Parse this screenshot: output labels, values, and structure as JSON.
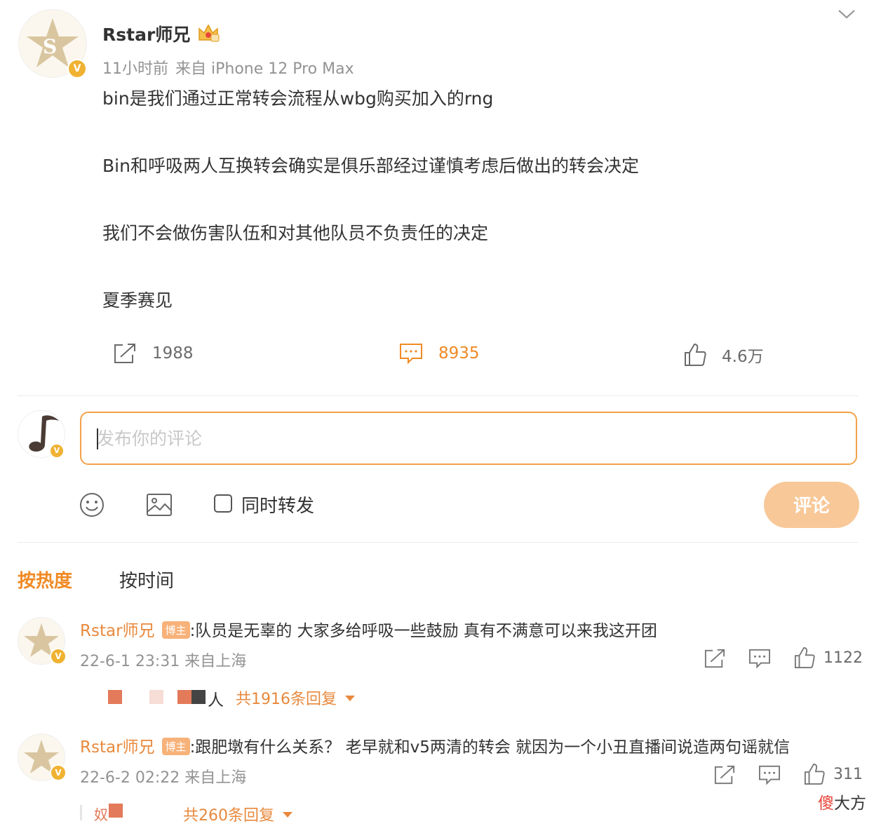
{
  "post": {
    "author": "Rstar师兄",
    "time": "11小时前",
    "source": "来自 iPhone 12 Pro Max",
    "paragraphs": [
      "bin是我们通过正常转会流程从wbg购买加入的rng",
      "Bin和呼吸两人互换转会确实是俱乐部经过谨慎考虑后做出的转会决定",
      "我们不会做伤害队伍和对其他队员不负责任的决定",
      "夏季赛见"
    ],
    "actions": {
      "repost_count": "1988",
      "comment_count": "8935",
      "like_count": "4.6万"
    }
  },
  "composer": {
    "placeholder": "发布你的评论",
    "repost_label": "同时转发",
    "submit_label": "评论"
  },
  "sort_tabs": {
    "hot": "按热度",
    "time": "按时间"
  },
  "comments": [
    {
      "author": "Rstar师兄",
      "badge": "博主",
      "text": ":队员是无辜的 大家多给呼吸一些鼓励 真有不满意可以来我这开团",
      "meta": "22-6-1 23:31 来自上海",
      "likes": "1122",
      "reply_preview_char": "人",
      "reply_summary": "共1916条回复"
    },
    {
      "author": "Rstar师兄",
      "badge": "博主",
      "text": ":跟肥墩有什么关系？ 老早就和v5两清的转会 就因为一个小丑直播间说造两句谣就信",
      "meta": "22-6-2 02:22 来自上海",
      "likes": "311",
      "reply_preview_char": "奴",
      "reply_summary": "共260条回复"
    }
  ],
  "overlay_text": {
    "highlight": "傻",
    "rest": "大方"
  },
  "colors": {
    "accent": "#f08a24",
    "name_orange": "#e8893d",
    "verified_badge": "#f0b232",
    "submit_disabled": "#f8c898"
  },
  "icons": [
    "crown-icon",
    "chevron-down-icon",
    "repost-icon",
    "comment-icon",
    "like-icon",
    "emoji-icon",
    "image-icon",
    "dropdown-triangle-icon",
    "verified-badge-icon"
  ]
}
